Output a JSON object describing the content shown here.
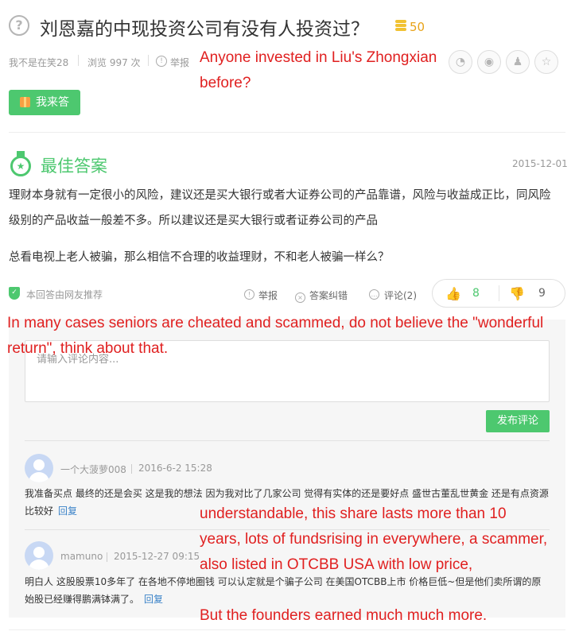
{
  "question": {
    "icon": "question-circle-icon",
    "title": "刘恩嘉的中现投资公司有没有人投资过？",
    "bounty": "50",
    "asker": "我不是在笑28",
    "views": "浏览 997 次",
    "report": "举报",
    "answer_button": "我来答"
  },
  "share_icons": [
    "wechat-icon",
    "weibo-icon",
    "qq-icon",
    "star-icon"
  ],
  "best_answer": {
    "heading": "最佳答案",
    "date": "2015-12-01",
    "paragraphs": [
      "理财本身就有一定很小的风险，建议还是买大银行或者大证券公司的产品靠谱，风险与收益成正比，同风险级别的产品收益一般差不多。所以建议还是买大银行或者证券公司的产品",
      "总看电视上老人被骗，那么相信不合理的收益理财，不和老人被骗一样么？"
    ],
    "recommended": "本回答由网友推荐",
    "report": "举报",
    "correct": "答案纠错",
    "comments": "评论(2)",
    "upvotes": "8",
    "downvotes": "9"
  },
  "comment_box": {
    "placeholder": "请输入评论内容...",
    "submit": "发布评论"
  },
  "comments": [
    {
      "user": "一个大菠萝008",
      "time": "2016-6-2 15:28",
      "text": "我准备买点 最终的还是会买 这是我的想法 因为我对比了几家公司 觉得有实体的还是要好点 盛世古董乱世黄金 还是有点资源比较好",
      "reply": "回复"
    },
    {
      "user": "mamuno",
      "time": "2015-12-27 09:15",
      "text": "明白人 这股股票10多年了 在各地不停地圈钱 可以认定就是个骗子公司 在美国OTCBB上市 价格巨低~但是他们卖所谓的原始股已经赚得鹏满钵满了。",
      "reply": "回复"
    }
  ],
  "annotations": [
    "Anyone invested in Liu's Zhongxian before?",
    "In many cases seniors are cheated and scammed, do not believe the \"wonderful return\", think about that.",
    "understandable, this share lasts more than 10 years, lots of fundsrising in everywhere, a scammer, also listed in OTCBB USA with low price,",
    "But the founders earned much much more."
  ],
  "colors": {
    "accent_green": "#4dc86f",
    "annotation_red": "#e02020",
    "bounty_gold": "#e8a217",
    "link_blue": "#3a82c8"
  }
}
